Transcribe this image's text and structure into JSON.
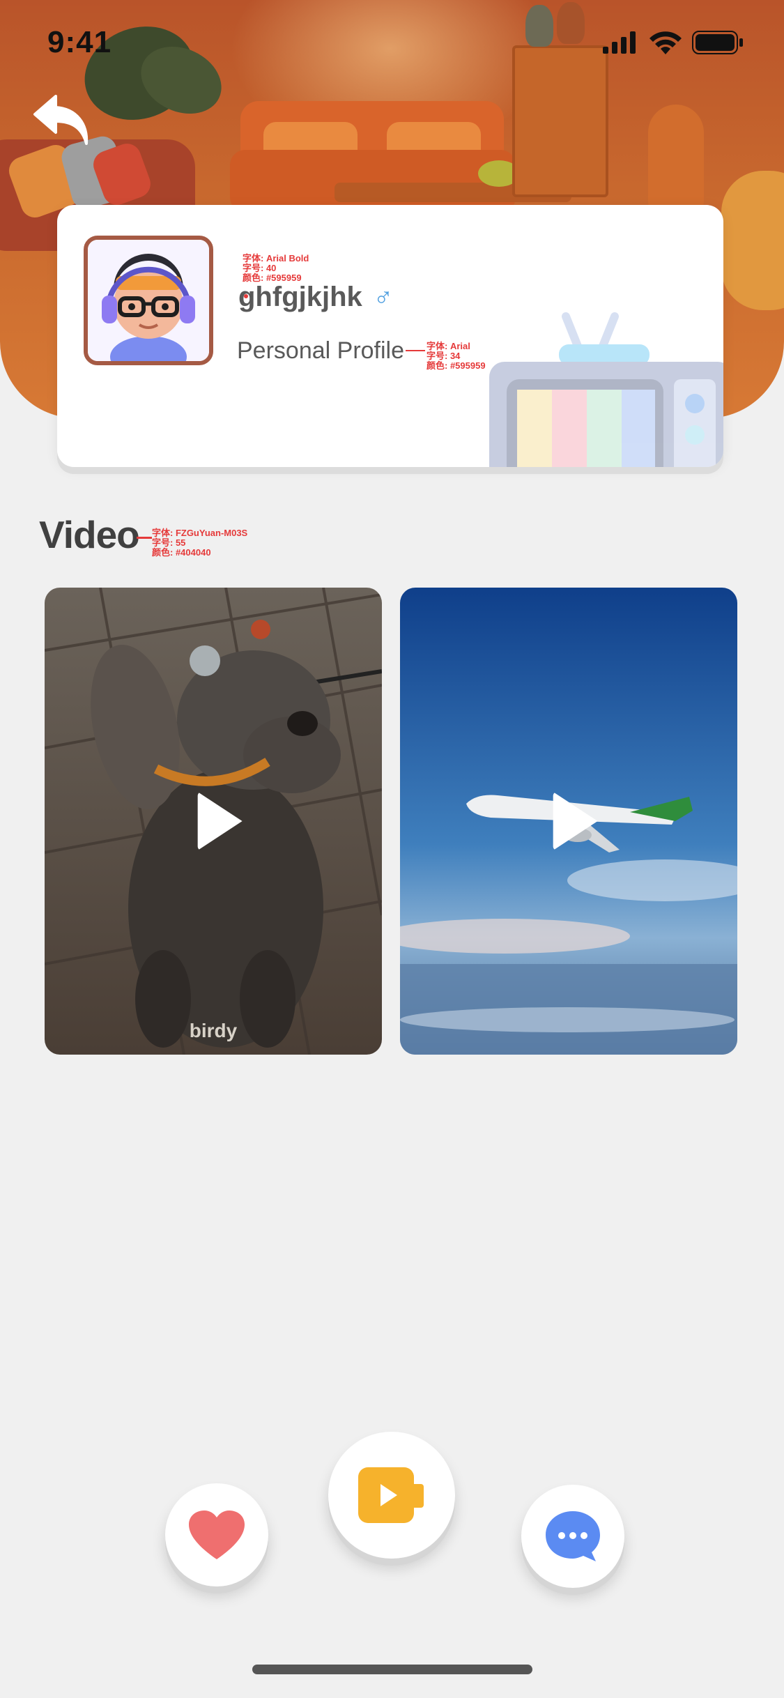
{
  "status_bar": {
    "time": "9:41"
  },
  "profile": {
    "name": "ghfgjkjhk",
    "gender_symbol": "♂",
    "subtitle": "Personal Profile",
    "annotations": {
      "name": [
        "字体: Arial Bold",
        "字号: 40",
        "颜色: #595959"
      ],
      "subtitle": [
        "字体: Arial",
        "字号: 34",
        "颜色: #595959"
      ]
    }
  },
  "section": {
    "title": "Video",
    "annotation": [
      "字体: FZGuYuan-M03S",
      "字号: 55",
      "颜色: #404040"
    ]
  },
  "videos": [
    {
      "thumbnail": "dog",
      "caption": "birdy"
    },
    {
      "thumbnail": "airplane",
      "caption": ""
    }
  ],
  "bottom_actions": [
    {
      "icon": "heart-icon",
      "color": "#ef6f6f"
    },
    {
      "icon": "video-camera-icon",
      "color": "#f6b22c"
    },
    {
      "icon": "chat-bubble-icon",
      "color": "#5b8bf2"
    }
  ],
  "colors": {
    "name_text": "#595959",
    "title_text": "#404040",
    "gender": "#4f9fe0",
    "background": "#f0f0f0"
  }
}
